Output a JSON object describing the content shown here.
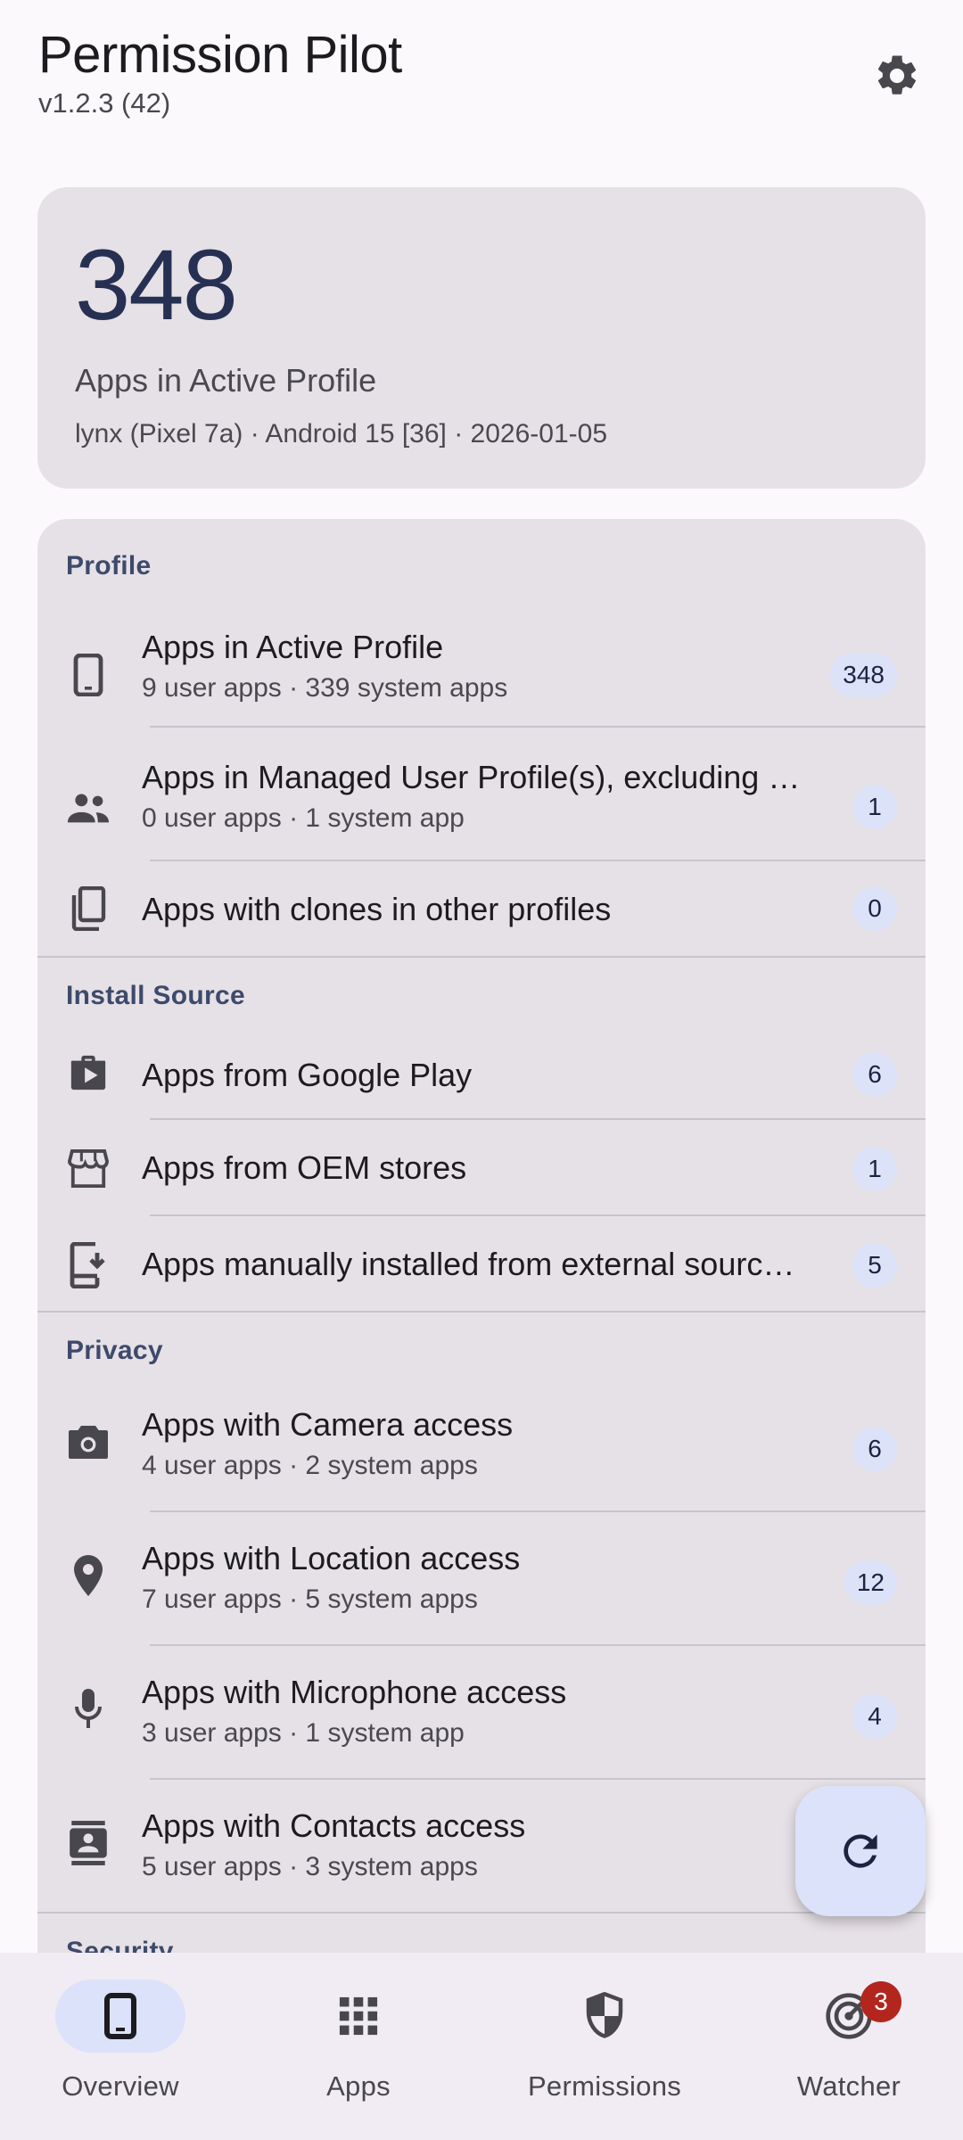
{
  "header": {
    "title": "Permission Pilot",
    "version": "v1.2.3 (42)",
    "settings_icon": "gear-icon"
  },
  "hero": {
    "count": "348",
    "label": "Apps in Active Profile",
    "device": "lynx (Pixel 7a) · Android 15 [36] · 2026-01-05"
  },
  "sections": {
    "profile": {
      "title": "Profile",
      "items": [
        {
          "title": "Apps in Active Profile",
          "subtitle": "9 user apps · 339 system apps",
          "count": "348",
          "icon": "phone-icon"
        },
        {
          "title": "Apps in Managed User Profile(s), excluding …",
          "subtitle": "0 user apps · 1 system app",
          "count": "1",
          "icon": "people-icon"
        },
        {
          "title": "Apps with clones in other profiles",
          "subtitle": "",
          "count": "0",
          "icon": "copy-icon"
        }
      ]
    },
    "install_source": {
      "title": "Install Source",
      "items": [
        {
          "title": "Apps from Google Play",
          "count": "6",
          "icon": "shop-bag-icon"
        },
        {
          "title": "Apps from OEM stores",
          "count": "1",
          "icon": "storefront-icon"
        },
        {
          "title": "Apps manually installed from external sourc…",
          "count": "5",
          "icon": "install-device-icon"
        }
      ]
    },
    "privacy": {
      "title": "Privacy",
      "items": [
        {
          "title": "Apps with Camera access",
          "subtitle": "4 user apps · 2 system apps",
          "count": "6",
          "icon": "camera-icon"
        },
        {
          "title": "Apps with Location access",
          "subtitle": "7 user apps · 5 system apps",
          "count": "12",
          "icon": "location-pin-icon"
        },
        {
          "title": "Apps with Microphone access",
          "subtitle": "3 user apps · 1 system app",
          "count": "4",
          "icon": "microphone-icon"
        },
        {
          "title": "Apps with Contacts access",
          "subtitle": "5 user apps · 3 system apps",
          "icon": "contacts-icon"
        }
      ]
    },
    "security": {
      "title": "Security"
    }
  },
  "fab": {
    "icon": "refresh-icon"
  },
  "nav": {
    "items": [
      {
        "label": "Overview",
        "icon": "phone-icon",
        "active": true
      },
      {
        "label": "Apps",
        "icon": "apps-grid-icon"
      },
      {
        "label": "Permissions",
        "icon": "shield-icon"
      },
      {
        "label": "Watcher",
        "icon": "radar-icon",
        "badge": "3"
      }
    ]
  },
  "colors": {
    "background": "#fcf9fc",
    "card": "#e6e1e6",
    "accent": "#263052",
    "badge_bg": "#dce2f8",
    "nav_badge": "#b3261e"
  }
}
